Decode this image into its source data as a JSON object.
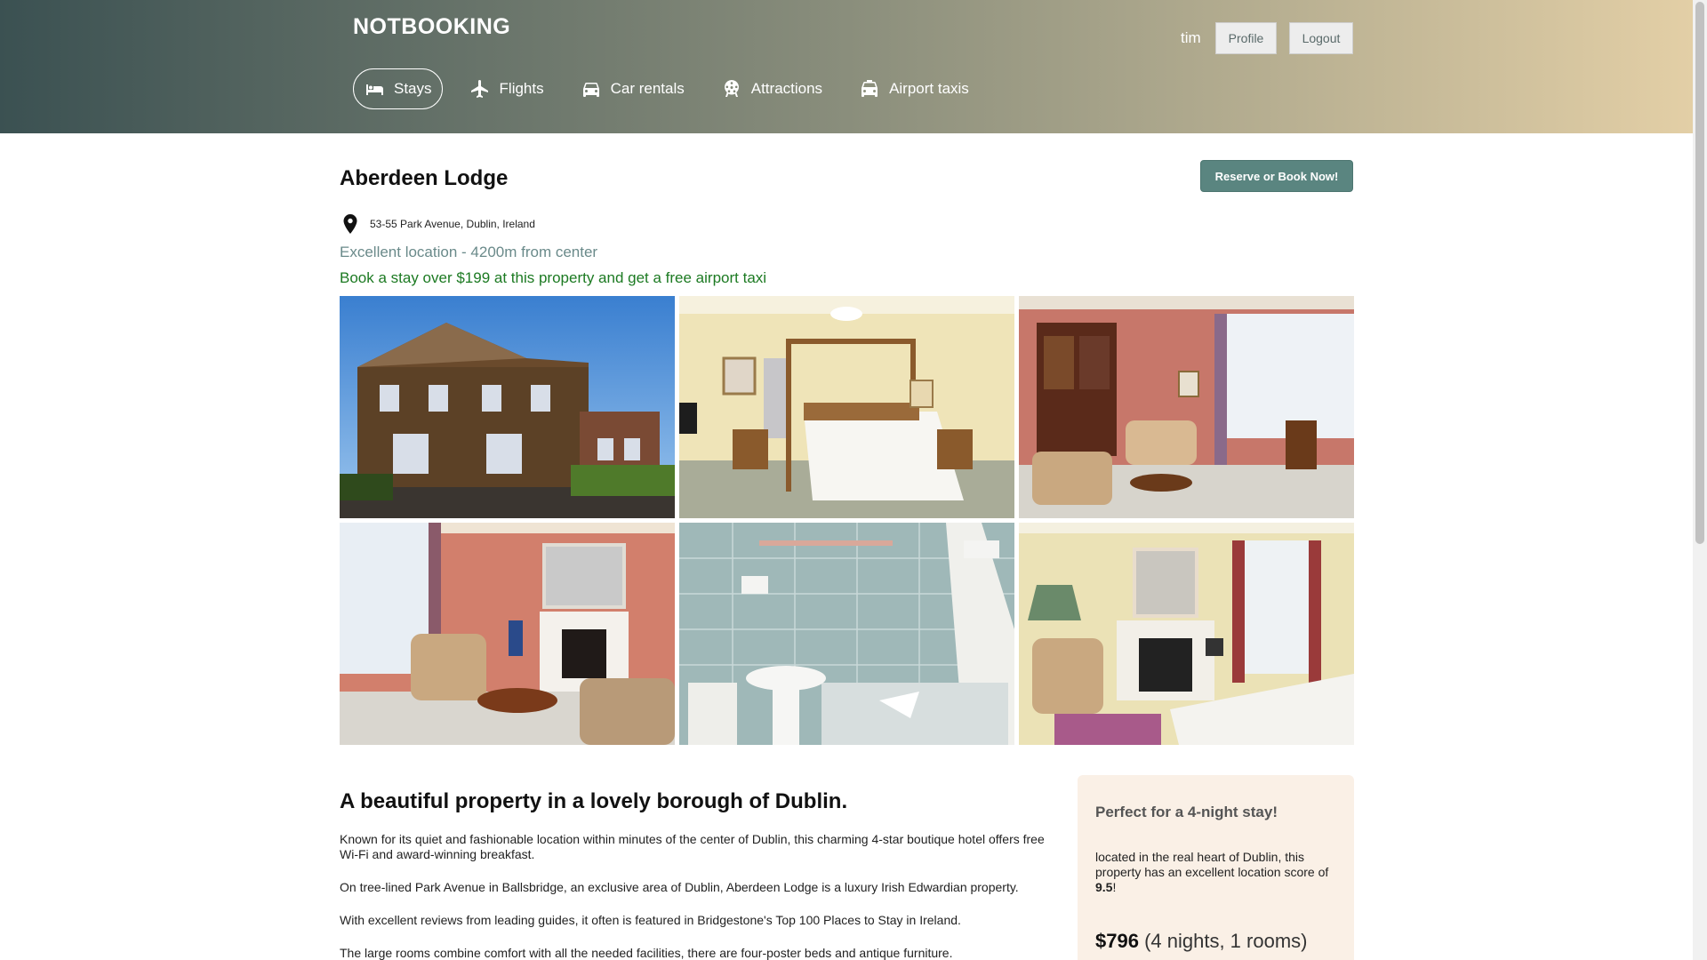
{
  "brand": "NOTBOOKING",
  "user": {
    "name": "tim",
    "profile_label": "Profile",
    "logout_label": "Logout"
  },
  "nav": {
    "items": [
      {
        "label": "Stays",
        "icon": "bed-icon",
        "active": true
      },
      {
        "label": "Flights",
        "icon": "plane-icon"
      },
      {
        "label": "Car rentals",
        "icon": "car-icon"
      },
      {
        "label": "Attractions",
        "icon": "attractions-icon"
      },
      {
        "label": "Airport taxis",
        "icon": "taxi-icon"
      }
    ]
  },
  "property": {
    "name": "Aberdeen Lodge",
    "reserve_label": "Reserve or Book Now!",
    "address": "53-55 Park Avenue, Dublin, Ireland",
    "location_note": "Excellent location - 4200m from center",
    "promo": "Book a stay over $199 at this property and get a free airport taxi",
    "photos": [
      "exterior-photo",
      "four-poster-bedroom-photo",
      "library-lounge-photo",
      "sitting-room-fireplace-photo",
      "bathroom-photo",
      "double-bedroom-photo"
    ]
  },
  "description": {
    "heading": "A beautiful property in a lovely borough of Dublin.",
    "paragraphs": [
      "Known for its quiet and fashionable location within minutes of the center of Dublin, this charming 4-star boutique hotel offers free Wi-Fi and award-winning breakfast.",
      "On tree-lined Park Avenue in Ballsbridge, an exclusive area of Dublin, Aberdeen Lodge is a luxury Irish Edwardian property.",
      "With excellent reviews from leading guides, it often is featured in Bridgestone's Top 100 Places to Stay in Ireland.",
      "The large rooms combine comfort with all the needed facilities, there are four-poster beds and antique furniture."
    ]
  },
  "sidebox": {
    "title": "Perfect for a 4-night stay!",
    "body_text": "located in the real heart of Dublin, this property has an excellent location score of",
    "score": "9.5",
    "score_suffix": "!",
    "price": "$796",
    "price_detail": "(4 nights, 1 rooms)"
  },
  "colors": {
    "accent_button": "#5a8580",
    "promo_green": "#1c7a22",
    "location_teal": "#6a8a8a",
    "sidebox_bg": "#faf0e6"
  }
}
